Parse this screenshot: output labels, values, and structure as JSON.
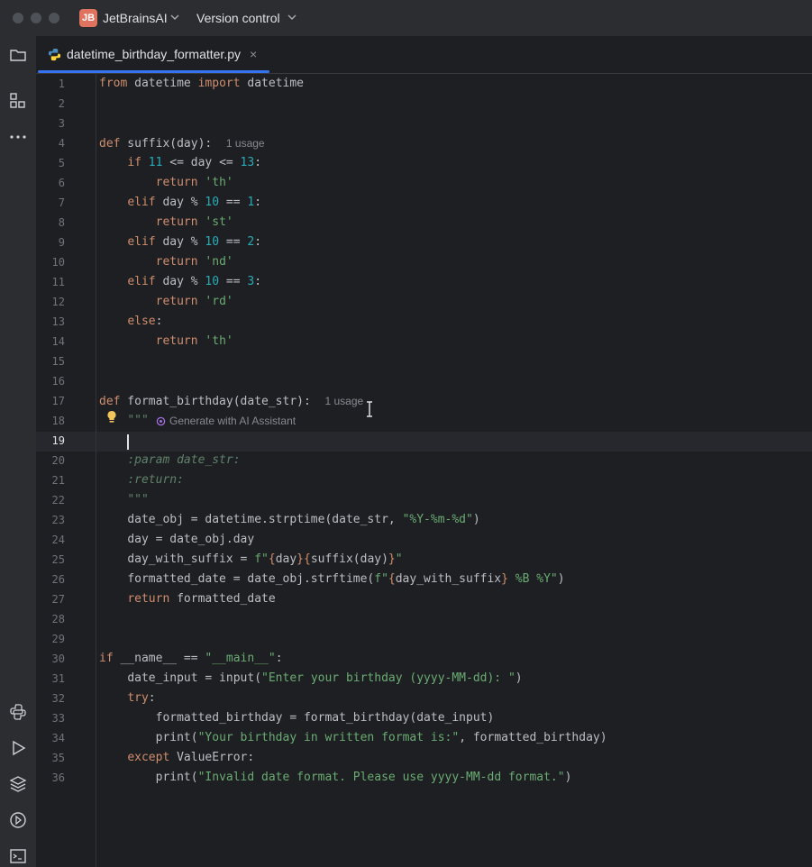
{
  "titlebar": {
    "project_badge": "JB",
    "project_name": "JetBrainsAI",
    "vcs_label": "Version control"
  },
  "tab": {
    "filename": "datetime_birthday_formatter.py",
    "close_glyph": "×"
  },
  "code_lines": [
    {
      "n": "1"
    },
    {
      "n": "2"
    },
    {
      "n": "3"
    },
    {
      "n": "4"
    },
    {
      "n": "5"
    },
    {
      "n": "6"
    },
    {
      "n": "7"
    },
    {
      "n": "8"
    },
    {
      "n": "9"
    },
    {
      "n": "10"
    },
    {
      "n": "11"
    },
    {
      "n": "12"
    },
    {
      "n": "13"
    },
    {
      "n": "14"
    },
    {
      "n": "15"
    },
    {
      "n": "16"
    },
    {
      "n": "17"
    },
    {
      "n": "18"
    },
    {
      "n": "19"
    },
    {
      "n": "20"
    },
    {
      "n": "21"
    },
    {
      "n": "22"
    },
    {
      "n": "23"
    },
    {
      "n": "24"
    },
    {
      "n": "25"
    },
    {
      "n": "26"
    },
    {
      "n": "27"
    },
    {
      "n": "28"
    },
    {
      "n": "29"
    },
    {
      "n": "30"
    },
    {
      "n": "31"
    },
    {
      "n": "32"
    },
    {
      "n": "33"
    },
    {
      "n": "34"
    },
    {
      "n": "35"
    },
    {
      "n": "36"
    }
  ],
  "code": {
    "l1_from": "from",
    "l1_mod": " datetime ",
    "l1_import": "import",
    "l1_name": " datetime",
    "l4_def": "def",
    "l4_sig": " suffix(day):",
    "l4_hint": "1 usage",
    "l5_if": "if",
    "l5_a": " ",
    "l5_n1": "11",
    "l5_b": " <= day <= ",
    "l5_n2": "13",
    "l5_c": ":",
    "l6_ret": "return",
    "l6_s": " 'th'",
    "l7_elif": "elif",
    "l7_a": " day % ",
    "l7_n1": "10",
    "l7_b": " == ",
    "l7_n2": "1",
    "l7_c": ":",
    "l8_ret": "return",
    "l8_s": " 'st'",
    "l9_elif": "elif",
    "l9_a": " day % ",
    "l9_n1": "10",
    "l9_b": " == ",
    "l9_n2": "2",
    "l9_c": ":",
    "l10_ret": "return",
    "l10_s": " 'nd'",
    "l11_elif": "elif",
    "l11_a": " day % ",
    "l11_n1": "10",
    "l11_b": " == ",
    "l11_n2": "3",
    "l11_c": ":",
    "l12_ret": "return",
    "l12_s": " 'rd'",
    "l13_else": "else",
    "l13_c": ":",
    "l14_ret": "return",
    "l14_s": " 'th'",
    "l17_def": "def",
    "l17_sig": " format_birthday(date_str):",
    "l17_hint": "1 usage",
    "l18_doc": "\"\"\"",
    "l18_ai": "Generate with AI Assistant",
    "l20_doc": ":param date_str:",
    "l21_doc": ":return:",
    "l22_doc": "\"\"\"",
    "l23_a": "date_obj = datetime.strptime(date_str, ",
    "l23_s": "\"%Y-%m-%d\"",
    "l23_b": ")",
    "l24": "day = date_obj.day",
    "l25_a": "day_with_suffix = ",
    "l25_f": "f\"",
    "l25_b1": "{",
    "l25_v1": "day",
    "l25_b2": "}{",
    "l25_v2": "suffix(day)",
    "l25_b3": "}",
    "l25_q": "\"",
    "l26_a": "formatted_date = date_obj.strftime(",
    "l26_f": "f\"",
    "l26_b1": "{",
    "l26_v1": "day_with_suffix",
    "l26_b2": "}",
    "l26_s": " %B %Y\"",
    "l26_c": ")",
    "l27_ret": "return",
    "l27_v": " formatted_date",
    "l30_if": "if",
    "l30_a": " __name__ == ",
    "l30_s": "\"__main__\"",
    "l30_c": ":",
    "l31_a": "date_input = input(",
    "l31_s": "\"Enter your birthday (yyyy-MM-dd): \"",
    "l31_c": ")",
    "l32_try": "try",
    "l32_c": ":",
    "l33": "formatted_birthday = format_birthday(date_input)",
    "l34_a": "print(",
    "l34_s": "\"Your birthday in written format is:\"",
    "l34_b": ", formatted_birthday)",
    "l35_exc": "except",
    "l35_a": " ValueError:",
    "l36_a": "print(",
    "l36_s": "\"Invalid date format. Please use yyyy-MM-dd format.\"",
    "l36_c": ")"
  },
  "colors": {
    "keyword": "#cf8e6d",
    "number": "#2aacb8",
    "string": "#6aab73",
    "docstring": "#5f826b",
    "accent": "#3574f0"
  },
  "icons": {
    "sidebar_top": [
      "folder-icon",
      "structure-icon",
      "more-icon"
    ],
    "sidebar_bottom": [
      "python-console-icon",
      "run-icon",
      "layers-icon",
      "services-icon",
      "terminal-icon"
    ]
  }
}
